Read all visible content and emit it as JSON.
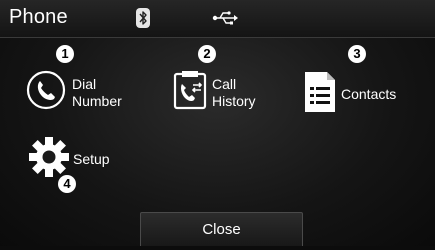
{
  "header": {
    "title": "Phone",
    "status_icons": [
      "bluetooth-icon",
      "usb-icon"
    ]
  },
  "menu": [
    {
      "number": "1",
      "label": "Dial\nNumber",
      "icon": "phone-handset-icon"
    },
    {
      "number": "2",
      "label": "Call\nHistory",
      "icon": "call-history-icon"
    },
    {
      "number": "3",
      "label": "Contacts",
      "icon": "contacts-icon"
    },
    {
      "number": "4",
      "label": "Setup",
      "icon": "gear-icon"
    }
  ],
  "footer": {
    "close_label": "Close"
  },
  "colors": {
    "background": "#151515",
    "text": "#ffffff"
  }
}
